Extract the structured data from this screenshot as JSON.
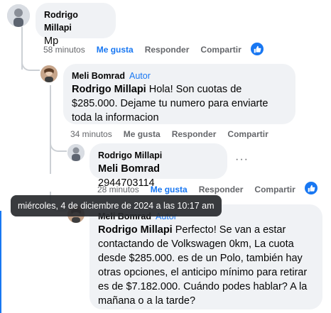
{
  "comments": [
    {
      "author": "Rodrigo Millapi",
      "text": "Mp",
      "time": "58 minutos",
      "like_label": "Me gusta",
      "reply_label": "Responder",
      "share_label": "Compartir",
      "liked": true
    },
    {
      "author": "Meli Bomrad",
      "badge": "Autor",
      "mention": "Rodrigo Millapi",
      "text": " Hola! Son cuotas de $285.000. Dejame tu numero para enviarte toda la informacion",
      "time": "34 minutos",
      "like_label": "Me gusta",
      "reply_label": "Responder",
      "share_label": "Compartir",
      "liked": false
    },
    {
      "author": "Rodrigo Millapi",
      "mention": "Meli Bomrad",
      "text": " 2944703114",
      "more": "···",
      "time": "28 minutos",
      "like_label": "Me gusta",
      "reply_label": "Responder",
      "share_label": "Compartir",
      "liked": true
    },
    {
      "author": "Meli Bomrad",
      "badge": "Autor",
      "mention": "Rodrigo Millapi",
      "text": " Perfecto! Se van a estar contactando de Volkswagen 0km, La cuota desde $285.000. es de un Polo, también hay otras opciones, el anticipo mínimo para retirar es de $7.182.000. Cuándo podes hablar? A la mañana o a la tarde?"
    }
  ],
  "tooltip": "miércoles, 4 de diciembre de 2024 a las 10:17 am",
  "colors": {
    "accent": "#1877f2",
    "bubble": "#f0f2f5",
    "muted": "#65676b"
  },
  "icons": {
    "like": "thumbs-up-icon"
  }
}
